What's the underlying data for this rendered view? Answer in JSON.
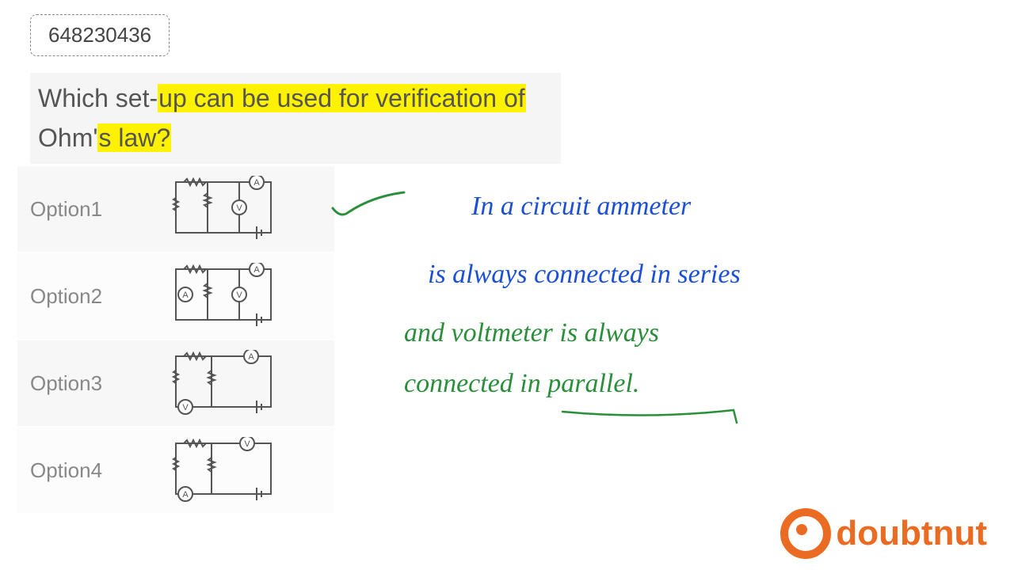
{
  "id_number": "648230436",
  "question": {
    "segments": [
      {
        "text": "Which set-",
        "hl": false
      },
      {
        "text": "up can be used for verification of",
        "hl": true
      },
      {
        "text": " Ohm'",
        "hl": false
      },
      {
        "text": "s law?",
        "hl": true
      }
    ]
  },
  "options": {
    "items": [
      {
        "label": "Option1"
      },
      {
        "label": "Option2"
      },
      {
        "label": "Option3"
      },
      {
        "label": "Option4"
      }
    ]
  },
  "correct_option": 1,
  "annotation": {
    "line1": "In a circuit ammeter",
    "line2": "is always connected in series",
    "line3": "and voltmeter is always",
    "line4": "connected in parallel."
  },
  "branding": "doubtnut",
  "colors": {
    "highlight": "#fff200",
    "blue_ink": "#1a4fd6",
    "green_ink": "#2a8f3a",
    "brand": "#ec6b23"
  }
}
